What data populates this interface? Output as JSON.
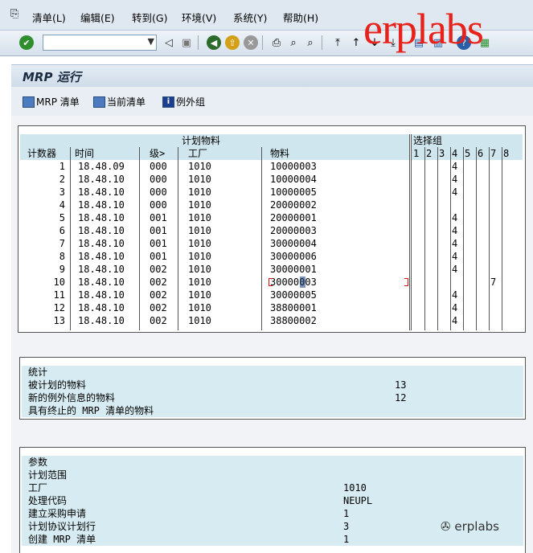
{
  "menu": [
    "清单(L)",
    "编辑(E)",
    "转到(G)",
    "环境(V)",
    "系统(Y)",
    "帮助(H)"
  ],
  "watermark": "erplabs",
  "watermark_footer": "erplabs",
  "title": "MRP 运行",
  "app_buttons": [
    "MRP 清单",
    "当前清单",
    "例外组"
  ],
  "table": {
    "group_header": "计划物料",
    "select_header": "选择组",
    "columns": [
      "计数器",
      "时间",
      "级>",
      "工厂",
      "物料"
    ],
    "select_cols": [
      "1",
      "2",
      "3",
      "4",
      "5",
      "6",
      "7",
      "8"
    ],
    "rows": [
      {
        "n": "1",
        "time": "18.48.09",
        "lvl": "000",
        "plant": "1010",
        "mat": "10000003",
        "s4": "4",
        "s7": ""
      },
      {
        "n": "2",
        "time": "18.48.10",
        "lvl": "000",
        "plant": "1010",
        "mat": "10000004",
        "s4": "4",
        "s7": ""
      },
      {
        "n": "3",
        "time": "18.48.10",
        "lvl": "000",
        "plant": "1010",
        "mat": "10000005",
        "s4": "4",
        "s7": ""
      },
      {
        "n": "4",
        "time": "18.48.10",
        "lvl": "000",
        "plant": "1010",
        "mat": "20000002",
        "s4": "",
        "s7": ""
      },
      {
        "n": "5",
        "time": "18.48.10",
        "lvl": "001",
        "plant": "1010",
        "mat": "20000001",
        "s4": "4",
        "s7": ""
      },
      {
        "n": "6",
        "time": "18.48.10",
        "lvl": "001",
        "plant": "1010",
        "mat": "20000003",
        "s4": "4",
        "s7": ""
      },
      {
        "n": "7",
        "time": "18.48.10",
        "lvl": "001",
        "plant": "1010",
        "mat": "30000004",
        "s4": "4",
        "s7": ""
      },
      {
        "n": "8",
        "time": "18.48.10",
        "lvl": "001",
        "plant": "1010",
        "mat": "30000006",
        "s4": "4",
        "s7": ""
      },
      {
        "n": "9",
        "time": "18.48.10",
        "lvl": "002",
        "plant": "1010",
        "mat": "30000001",
        "s4": "4",
        "s7": ""
      },
      {
        "n": "10",
        "time": "18.48.10",
        "lvl": "002",
        "plant": "1010",
        "mat": "30000003",
        "s4": "",
        "s7": "7"
      },
      {
        "n": "11",
        "time": "18.48.10",
        "lvl": "002",
        "plant": "1010",
        "mat": "30000005",
        "s4": "4",
        "s7": ""
      },
      {
        "n": "12",
        "time": "18.48.10",
        "lvl": "002",
        "plant": "1010",
        "mat": "38800001",
        "s4": "4",
        "s7": ""
      },
      {
        "n": "13",
        "time": "18.48.10",
        "lvl": "002",
        "plant": "1010",
        "mat": "38800002",
        "s4": "4",
        "s7": ""
      }
    ]
  },
  "stats": {
    "header": "统计",
    "rows": [
      {
        "label": "被计划的物料",
        "value": "13"
      },
      {
        "label": "新的例外信息的物料",
        "value": "12"
      },
      {
        "label": "具有终止的 MRP 清单的物料",
        "value": ""
      }
    ]
  },
  "params": {
    "header": "参数",
    "rows": [
      {
        "label": "计划范围",
        "value": ""
      },
      {
        "label": "工厂",
        "value": "1010"
      },
      {
        "label": "处理代码",
        "value": "NEUPL"
      },
      {
        "label": "建立采购申请",
        "value": "1"
      },
      {
        "label": "计划协议计划行",
        "value": "3"
      },
      {
        "label": "创建 MRP 清单",
        "value": "1"
      }
    ]
  },
  "icons": [
    "enter-icon",
    "back-icon",
    "save-icon",
    "exit-icon",
    "cancel-icon",
    "print-icon",
    "find-icon",
    "find-next-icon",
    "first-page-icon",
    "prev-page-icon",
    "next-page-icon",
    "last-page-icon",
    "new-session-icon",
    "shortcut-icon",
    "help-icon",
    "layout-icon"
  ]
}
